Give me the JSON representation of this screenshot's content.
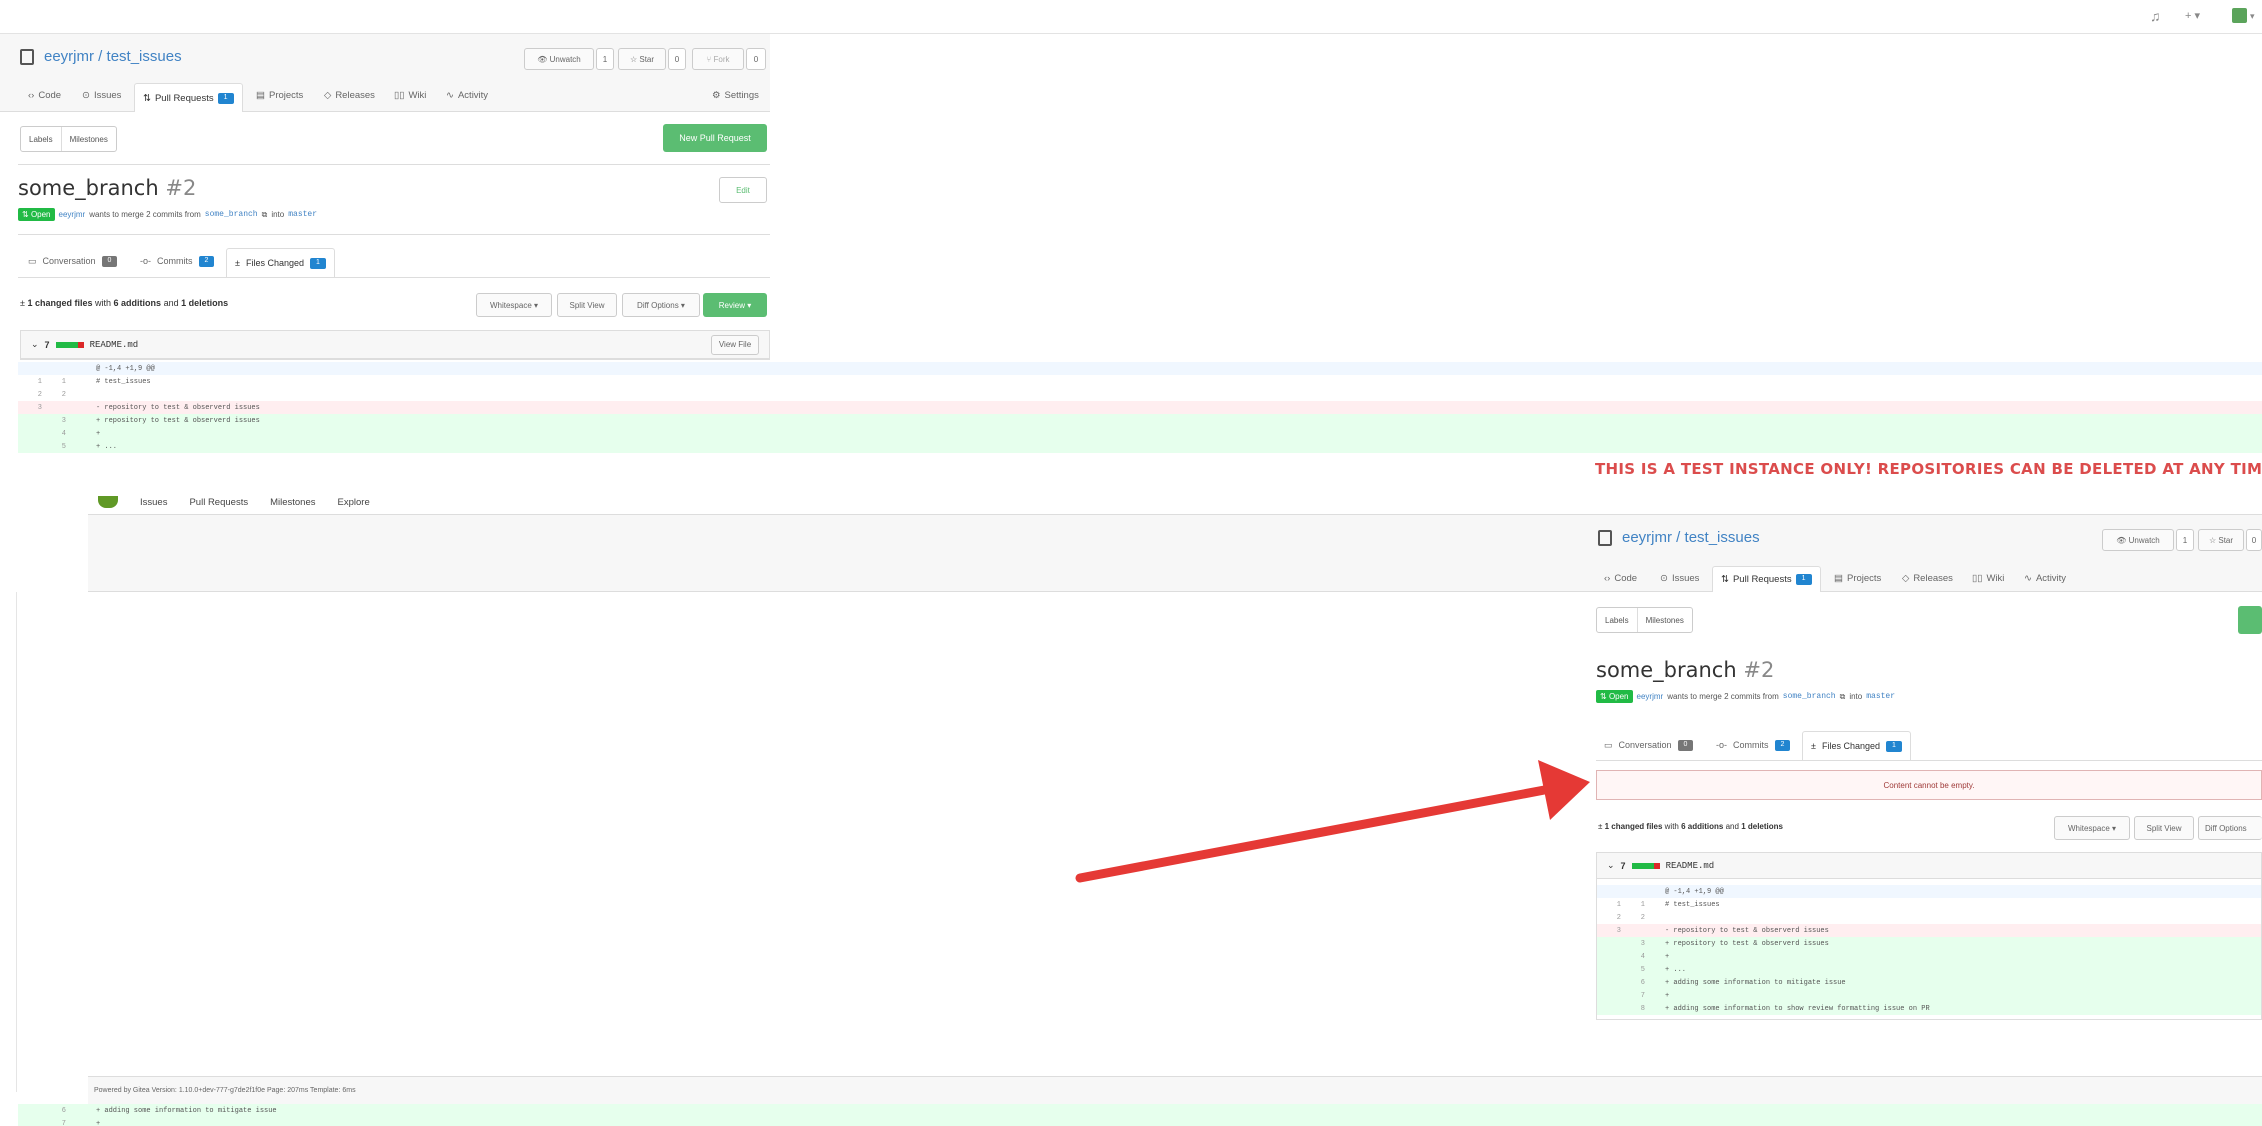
{
  "topbar": {
    "bell_icon": "bell-icon",
    "plus_label": "+ ▾",
    "avatar_caret": "▾"
  },
  "repo": {
    "owner": "eeyrjmr",
    "sep": " / ",
    "name": "test_issues",
    "unwatch_label": "Unwatch",
    "watch_count": "1",
    "star_label": "Star",
    "star_count": "0",
    "fork_label": "Fork",
    "fork_count": "0"
  },
  "repo_nav": {
    "code": "Code",
    "issues": "Issues",
    "pull_requests": "Pull Requests",
    "pull_requests_count": "1",
    "projects": "Projects",
    "releases": "Releases",
    "wiki": "Wiki",
    "activity": "Activity",
    "settings": "Settings"
  },
  "filters": {
    "labels": "Labels",
    "milestones": "Milestones",
    "new_pr": "New Pull Request"
  },
  "pr": {
    "title": "some_branch",
    "number": "#2",
    "edit": "Edit",
    "status": "Open",
    "author": "eeyrjmr",
    "merge_text": "wants to merge 2 commits from",
    "head_branch": "some_branch",
    "into": "into",
    "base_branch": "master"
  },
  "pr_tabs": {
    "conversation": "Conversation",
    "conversation_count": "0",
    "commits": "Commits",
    "commits_count": "2",
    "files_changed": "Files Changed",
    "files_changed_count": "1"
  },
  "diff_toolbar": {
    "summary_a": "1 changed files",
    "summary_b": "with",
    "summary_c": "6 additions",
    "summary_d": "and",
    "summary_e": "1 deletions",
    "whitespace": "Whitespace",
    "split_view": "Split View",
    "diff_options": "Diff Options",
    "review": "Review"
  },
  "file": {
    "count": "7",
    "name": "README.md",
    "view_file": "View File"
  },
  "diff_lines_top": [
    {
      "type": "hunk",
      "old": "",
      "new": "",
      "text": "@ -1,4 +1,9 @@"
    },
    {
      "type": "ctx",
      "old": "1",
      "new": "1",
      "text": "# test_issues"
    },
    {
      "type": "ctx",
      "old": "2",
      "new": "2",
      "text": ""
    },
    {
      "type": "del",
      "old": "3",
      "new": "",
      "text": "- repository to test & observerd issues"
    },
    {
      "type": "add",
      "old": "",
      "new": "3",
      "text": "+ repository to test & observerd issues"
    },
    {
      "type": "add",
      "old": "",
      "new": "4",
      "text": "+"
    },
    {
      "type": "add",
      "old": "",
      "new": "5",
      "text": "+ ..."
    }
  ],
  "banner": {
    "text": "THIS IS A TEST INSTANCE ONLY! REPOSITORIES CAN BE DELETED AT ANY TIM"
  },
  "navbar": {
    "logo": "gitea-logo-icon",
    "issues": "Issues",
    "pull_requests": "Pull Requests",
    "milestones": "Milestones",
    "explore": "Explore"
  },
  "error": {
    "message": "Content cannot be empty."
  },
  "diff_lines_inner": [
    {
      "type": "hunk",
      "old": "",
      "new": "",
      "text": "@ -1,4 +1,9 @@"
    },
    {
      "type": "ctx",
      "old": "1",
      "new": "1",
      "text": "# test_issues"
    },
    {
      "type": "ctx",
      "old": "2",
      "new": "2",
      "text": ""
    },
    {
      "type": "del",
      "old": "3",
      "new": "",
      "text": "- repository to test & observerd issues"
    },
    {
      "type": "add",
      "old": "",
      "new": "3",
      "text": "+ repository to test & observerd issues"
    },
    {
      "type": "add",
      "old": "",
      "new": "4",
      "text": "+"
    },
    {
      "type": "add",
      "old": "",
      "new": "5",
      "text": "+ ..."
    },
    {
      "type": "add",
      "old": "",
      "new": "6",
      "text": "+ adding some information to mitigate issue"
    },
    {
      "type": "add",
      "old": "",
      "new": "7",
      "text": "+"
    },
    {
      "type": "add",
      "old": "",
      "new": "8",
      "text": "+ adding some information to show review formatting issue on PR"
    }
  ],
  "footer": {
    "powered": "Powered by Gitea Version: 1.10.0+dev-777-g7de2f1f0e Page: 207ms Template: 6ms"
  },
  "diff_lines_bottom": [
    {
      "type": "add",
      "old": "",
      "new": "6",
      "text": "+ adding some information to mitigate issue"
    },
    {
      "type": "add",
      "old": "",
      "new": "7",
      "text": "+"
    }
  ],
  "colors": {
    "accent": "#4183c4",
    "green": "#5bbd72",
    "arrow": "#e53935",
    "warning": "#db4c4c"
  }
}
